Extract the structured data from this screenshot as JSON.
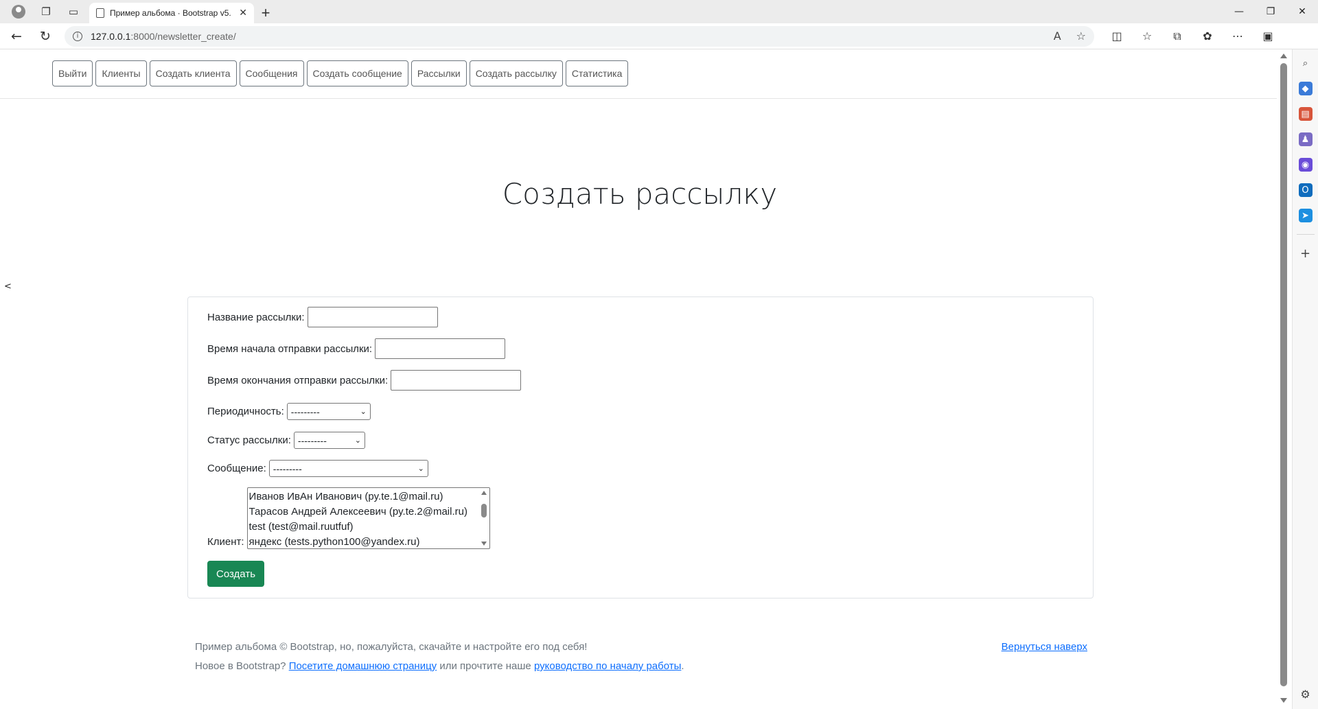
{
  "browser": {
    "tab_title": "Пример альбома · Bootstrap v5.",
    "url_host": "127.0.0.1",
    "url_path": ":8000/newsletter_create/"
  },
  "nav": {
    "items": [
      "Выйти",
      "Клиенты",
      "Создать клиента",
      "Сообщения",
      "Создать сообщение",
      "Рассылки",
      "Создать рассылку",
      "Статистика"
    ]
  },
  "page": {
    "title": "Создать рассылку"
  },
  "form": {
    "name_label": "Название рассылки:",
    "start_label": "Время начала отправки рассылки:",
    "end_label": "Время окончания отправки рассылки:",
    "period_label": "Периодичность:",
    "period_value": "---------",
    "status_label": "Статус рассылки:",
    "status_value": "---------",
    "message_label": "Сообщение:",
    "message_value": "---------",
    "client_label": "Клиент:",
    "clients": [
      "Иванов ИвАн Иванович (py.te.1@mail.ru)",
      "Тарасов Андрей Алексеевич (py.te.2@mail.ru)",
      "test (test@mail.ruutfuf)",
      "яндекс (tests.python100@yandex.ru)"
    ],
    "submit_label": "Создать"
  },
  "footer": {
    "line1": "Пример альбома © Bootstrap, но, пожалуйста, скачайте и настройте его под себя!",
    "line2_prefix": "Новое в Bootstrap? ",
    "line2_link1": "Посетите домашнюю страницу",
    "line2_middle": " или прочтите наше ",
    "line2_link2": "руководство по началу работы",
    "line2_suffix": ".",
    "back_to_top": "Вернуться наверх"
  }
}
